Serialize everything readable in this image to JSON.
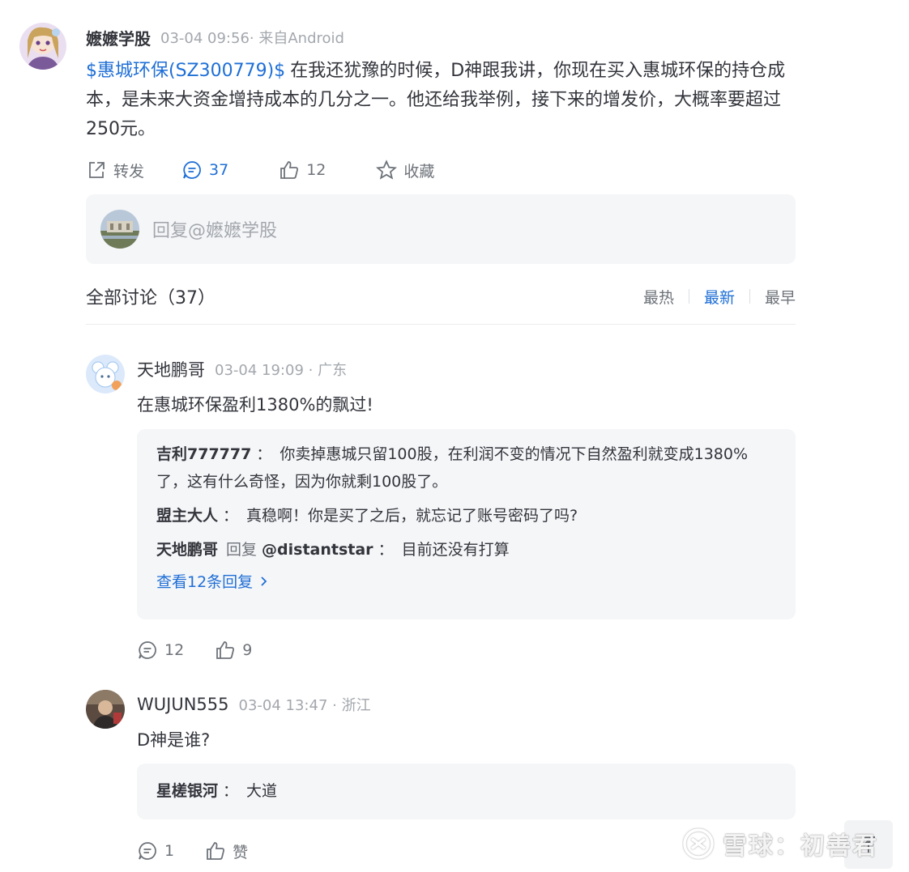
{
  "post": {
    "author": "嬷嬷学股",
    "meta": "03-04 09:56· 来自Android",
    "stock_link": "$惠城环保(SZ300779)$",
    "text": "在我还犹豫的时候，D神跟我讲，你现在买入惠城环保的持仓成本，是未来大资金增持成本的几分之一。他还给我举例，接下来的增发价，大概率要超过250元。",
    "actions": {
      "repost_label": "转发",
      "comment_count": "37",
      "like_count": "12",
      "favorite_label": "收藏"
    }
  },
  "reply_box": {
    "placeholder": "回复@嬷嬷学股"
  },
  "discussion": {
    "title": "全部讨论（37）",
    "sort_hot": "最热",
    "sort_new": "最新",
    "sort_early": "最早"
  },
  "comments": [
    {
      "name": "天地鹏哥",
      "meta": "03-04 19:09 · 广东",
      "text": "在惠城环保盈利1380%的飘过!",
      "replies": [
        {
          "user": "吉利777777",
          "colon": "：",
          "text": "你卖掉惠城只留100股，在利润不变的情况下自然盈利就变成1380%了，这有什么奇怪，因为你就剩100股了。"
        },
        {
          "user": "盟主大人",
          "colon": "：",
          "text": "真稳啊！你是买了之后，就忘记了账号密码了吗?"
        },
        {
          "user": "天地鹏哥",
          "reply_word": "回复",
          "reply_to": "@distantstar",
          "colon": "：",
          "text": "目前还没有打算"
        }
      ],
      "view_more": "查看12条回复",
      "comment_count": "12",
      "like_count": "9"
    },
    {
      "name": "WUJUN555",
      "meta": "03-04 13:47 · 浙江",
      "text": "D神是谁?",
      "replies": [
        {
          "user": "星槎银河",
          "colon": "：",
          "text": "大道"
        }
      ],
      "comment_count": "1",
      "like_label": "赞"
    }
  ],
  "watermark": "雪球：初善君"
}
